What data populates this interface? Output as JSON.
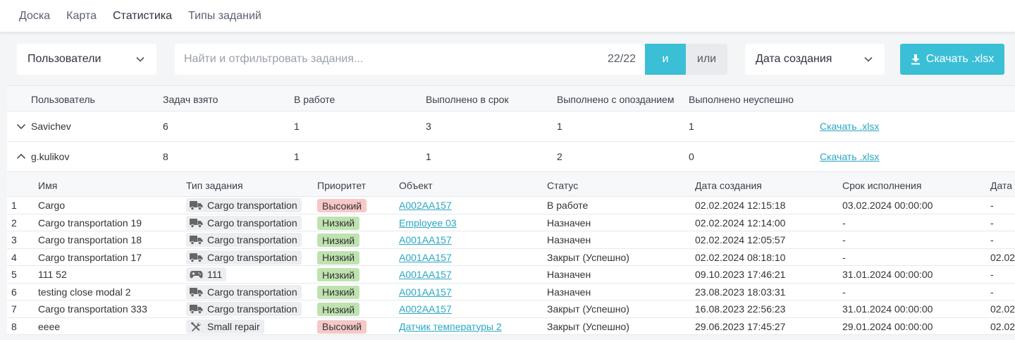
{
  "nav": [
    "Доска",
    "Карта",
    "Статистика",
    "Типы заданий"
  ],
  "toolbar": {
    "users_dropdown": "Пользователи",
    "search_placeholder": "Найти и отфильтровать задания...",
    "search_count": "22/22",
    "and_label": "и",
    "or_label": "или",
    "date_dropdown": "Дата создания",
    "download_label": "Скачать .xlsx"
  },
  "colors": {
    "accent": "#3bbfd6",
    "high_priority": "#f6c8c8",
    "low_priority": "#bfe3b0",
    "link": "#2aa7c4"
  },
  "stats": {
    "headers": [
      "Пользователь",
      "Задач взято",
      "В работе",
      "Выполнено в срок",
      "Выполнено с опозданием",
      "Выполнено неуспешно"
    ],
    "rows": [
      {
        "user": "Savichev",
        "taken": "6",
        "in_work": "1",
        "on_time": "3",
        "late": "1",
        "failed": "1",
        "link": "Скачать .xlsx",
        "expanded": false
      },
      {
        "user": "g.kulikov",
        "taken": "8",
        "in_work": "1",
        "on_time": "1",
        "late": "2",
        "failed": "0",
        "link": "Скачать .xlsx",
        "expanded": true
      }
    ]
  },
  "tasks": {
    "headers": [
      "Имя",
      "Тип задания",
      "Приоритет",
      "Объект",
      "Статус",
      "Дата создания",
      "Срок исполнения",
      "Дата"
    ],
    "rows": [
      {
        "num": "1",
        "name": "Cargo",
        "type": "Cargo transportation",
        "type_icon": "truck-icon",
        "priority": "Высокий",
        "priority_level": "high",
        "object": "A002AA157",
        "status": "В работе",
        "created": "02.02.2024 12:15:18",
        "deadline": "03.02.2024 00:00:00",
        "date": "-"
      },
      {
        "num": "2",
        "name": "Cargo transportation 19",
        "type": "Cargo transportation",
        "type_icon": "truck-icon",
        "priority": "Низкий",
        "priority_level": "low",
        "object": "Employee 03",
        "status": "Назначен",
        "created": "02.02.2024 12:14:00",
        "deadline": "-",
        "date": "-"
      },
      {
        "num": "3",
        "name": "Cargo transportation 18",
        "type": "Cargo transportation",
        "type_icon": "truck-icon",
        "priority": "Низкий",
        "priority_level": "low",
        "object": "A001AA157",
        "status": "Назначен",
        "created": "02.02.2024 12:05:57",
        "deadline": "-",
        "date": "-"
      },
      {
        "num": "4",
        "name": "Cargo transportation 17",
        "type": "Cargo transportation",
        "type_icon": "truck-icon",
        "priority": "Низкий",
        "priority_level": "low",
        "object": "A001AA157",
        "status": "Закрыт (Успешно)",
        "created": "02.02.2024 08:18:10",
        "deadline": "-",
        "date": "02.02."
      },
      {
        "num": "5",
        "name": "111 52",
        "type": "111",
        "type_icon": "gamepad-icon",
        "priority": "Низкий",
        "priority_level": "low",
        "object": "A001AA157",
        "status": "Назначен",
        "created": "09.10.2023 17:46:21",
        "deadline": "31.01.2024 00:00:00",
        "date": "-"
      },
      {
        "num": "6",
        "name": "testing close modal 2",
        "type": "Cargo transportation",
        "type_icon": "truck-icon",
        "priority": "Низкий",
        "priority_level": "low",
        "object": "A001AA157",
        "status": "Назначен",
        "created": "23.08.2023 18:03:31",
        "deadline": "-",
        "date": "-"
      },
      {
        "num": "7",
        "name": "Cargo transportation 333",
        "type": "Cargo transportation",
        "type_icon": "truck-icon",
        "priority": "Низкий",
        "priority_level": "low",
        "object": "A002AA157",
        "status": "Закрыт (Успешно)",
        "created": "16.08.2023 22:56:23",
        "deadline": "31.01.2024 00:00:00",
        "date": "02.02."
      },
      {
        "num": "8",
        "name": "eeee",
        "type": "Small repair",
        "type_icon": "tools-icon",
        "priority": "Высокий",
        "priority_level": "high",
        "object": "Датчик температуры 2",
        "status": "Закрыт (Успешно)",
        "created": "29.06.2023 17:45:27",
        "deadline": "29.01.2024 00:00:00",
        "date": "02.02."
      }
    ]
  }
}
